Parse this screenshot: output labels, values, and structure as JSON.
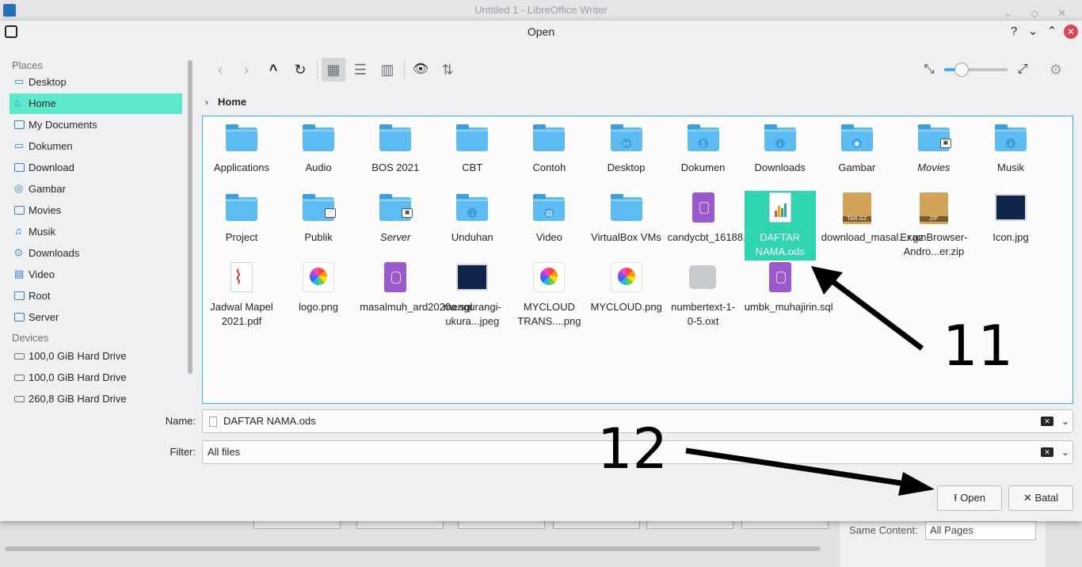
{
  "background_window": {
    "title": "Untitled 1 - LibreOffice Writer",
    "same_content_label": "Same Content:",
    "same_content_value": "All Pages"
  },
  "dialog": {
    "title": "Open",
    "controls": {
      "help": "?",
      "minimize": "⌄",
      "maximize": "⌃",
      "close": "✕"
    }
  },
  "places": {
    "places_header": "Places",
    "items": [
      {
        "label": "Desktop",
        "icon": "desktop-folder-icon"
      },
      {
        "label": "Home",
        "icon": "home-icon",
        "active": true
      },
      {
        "label": "My Documents",
        "icon": "folder-icon"
      },
      {
        "label": "Dokumen",
        "icon": "document-folder-icon"
      },
      {
        "label": "Download",
        "icon": "folder-icon"
      },
      {
        "label": "Gambar",
        "icon": "camera-icon"
      },
      {
        "label": "Movies",
        "icon": "folder-icon"
      },
      {
        "label": "Musik",
        "icon": "music-note-icon"
      },
      {
        "label": "Downloads",
        "icon": "download-icon"
      },
      {
        "label": "Video",
        "icon": "film-icon"
      },
      {
        "label": "Root",
        "icon": "folder-icon"
      },
      {
        "label": "Server",
        "icon": "folder-icon"
      }
    ],
    "devices_header": "Devices",
    "devices": [
      {
        "label": "100,0 GiB Hard Drive",
        "icon": "hard-drive-icon"
      },
      {
        "label": "100,0 GiB Hard Drive",
        "icon": "hard-drive-icon"
      },
      {
        "label": "260,8 GiB Hard Drive",
        "icon": "hard-drive-icon"
      }
    ]
  },
  "toolbar": {
    "back": "‹",
    "forward": "›",
    "up": "^",
    "reload": "↻",
    "icons_view": "▦",
    "details_view": "☰",
    "columns_view": "▥",
    "preview": "👁",
    "sort": "⇅",
    "zoom_level": 0.28
  },
  "breadcrumb": {
    "current": "Home"
  },
  "files": [
    {
      "label": "Applications",
      "type": "folder"
    },
    {
      "label": "Audio",
      "type": "folder"
    },
    {
      "label": "BOS 2021",
      "type": "folder"
    },
    {
      "label": "CBT",
      "type": "folder"
    },
    {
      "label": "Contoh",
      "type": "folder"
    },
    {
      "label": "Desktop",
      "type": "folder"
    },
    {
      "label": "Dokumen",
      "type": "folder"
    },
    {
      "label": "Downloads",
      "type": "folder"
    },
    {
      "label": "Gambar",
      "type": "folder"
    },
    {
      "label": "Movies",
      "type": "folder",
      "italic": true
    },
    {
      "label": "Musik",
      "type": "folder"
    },
    {
      "label": "Project",
      "type": "folder"
    },
    {
      "label": "Publik",
      "type": "folder"
    },
    {
      "label": "Server",
      "type": "folder",
      "italic": true
    },
    {
      "label": "Unduhan",
      "type": "folder"
    },
    {
      "label": "Video",
      "type": "folder"
    },
    {
      "label": "VirtualBox VMs",
      "type": "folder"
    },
    {
      "label": "candycbt_16188....sql",
      "type": "sql"
    },
    {
      "label": "DAFTAR NAMA.ods",
      "type": "spreadsheet",
      "selected": true
    },
    {
      "label": "download_masal...r.gz",
      "type": "archive",
      "badge": "TAR.GZ"
    },
    {
      "label": "ExamBrowser-Andro...er.zip",
      "type": "archive",
      "badge": "ZIP"
    },
    {
      "label": "Icon.jpg",
      "type": "image-dark"
    },
    {
      "label": "Jadwal Mapel 2021.pdf",
      "type": "pdf"
    },
    {
      "label": "logo.png",
      "type": "photos"
    },
    {
      "label": "masalmuh_ard2020a.sql",
      "type": "sql"
    },
    {
      "label": "mengurangi-ukura...jpeg",
      "type": "image-dark"
    },
    {
      "label": "MYCLOUD TRANS....png",
      "type": "photos"
    },
    {
      "label": "MYCLOUD.png",
      "type": "photos"
    },
    {
      "label": "numbertext-1-0-5.oxt",
      "type": "plugin"
    },
    {
      "label": "umbk_muhajirin.sql",
      "type": "sql"
    }
  ],
  "name_row": {
    "label": "Name:",
    "value": "DAFTAR NAMA.ods"
  },
  "filter_row": {
    "label": "Filter:",
    "value": "All files"
  },
  "buttons": {
    "open": "Open",
    "cancel": "Batal"
  },
  "annotations": [
    {
      "number": "11",
      "points_to": "DAFTAR NAMA.ods"
    },
    {
      "number": "12",
      "points_to": "Open"
    }
  ],
  "colors": {
    "accent": "#3daee9",
    "selection": "#2ed5b0",
    "places_active": "#5deacc",
    "folder": "#5dbcf2"
  }
}
